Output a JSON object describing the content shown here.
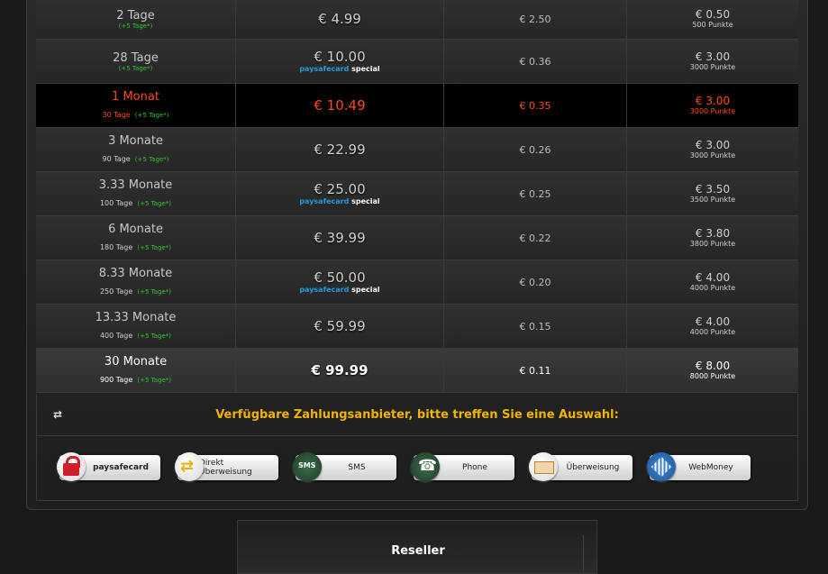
{
  "pricing_rows": [
    {
      "duration": "2 Tage",
      "sub": "",
      "bonus": "(+5 Tage*)",
      "price": "€ 4.99",
      "psc_special": false,
      "per_day": "€ 2.50",
      "points": "€ 0.50",
      "points_label": "500 Punkte",
      "style": "normal"
    },
    {
      "duration": "28 Tage",
      "sub": "",
      "bonus": "(+5 Tage*)",
      "price": "€ 10.00",
      "psc_special": true,
      "per_day": "€ 0.36",
      "points": "€ 3.00",
      "points_label": "3000 Punkte",
      "style": "normal"
    },
    {
      "duration": "1 Monat",
      "sub": "30 Tage",
      "bonus": "(+5 Tage*)",
      "price": "€ 10.49",
      "psc_special": false,
      "per_day": "€ 0.35",
      "points": "€ 3.00",
      "points_label": "3000 Punkte",
      "style": "highlight"
    },
    {
      "duration": "3 Monate",
      "sub": "90 Tage",
      "bonus": "(+5 Tage*)",
      "price": "€ 22.99",
      "psc_special": false,
      "per_day": "€ 0.26",
      "points": "€ 3.00",
      "points_label": "3000 Punkte",
      "style": "normal"
    },
    {
      "duration": "3.33 Monate",
      "sub": "100 Tage",
      "bonus": "(+5 Tage*)",
      "price": "€ 25.00",
      "psc_special": true,
      "per_day": "€ 0.25",
      "points": "€ 3.50",
      "points_label": "3500 Punkte",
      "style": "normal"
    },
    {
      "duration": "6 Monate",
      "sub": "180 Tage",
      "bonus": "(+5 Tage*)",
      "price": "€ 39.99",
      "psc_special": false,
      "per_day": "€ 0.22",
      "points": "€ 3.80",
      "points_label": "3800 Punkte",
      "style": "normal"
    },
    {
      "duration": "8.33 Monate",
      "sub": "250 Tage",
      "bonus": "(+5 Tage*)",
      "price": "€ 50.00",
      "psc_special": true,
      "per_day": "€ 0.20",
      "points": "€ 4.00",
      "points_label": "4000 Punkte",
      "style": "normal"
    },
    {
      "duration": "13.33 Monate",
      "sub": "400 Tage",
      "bonus": "(+5 Tage*)",
      "price": "€ 59.99",
      "psc_special": false,
      "per_day": "€ 0.15",
      "points": "€ 4.00",
      "points_label": "4000 Punkte",
      "style": "normal"
    },
    {
      "duration": "30 Monate",
      "sub": "900 Tage",
      "bonus": "(+5 Tage*)",
      "price": "€ 99.99",
      "psc_special": false,
      "per_day": "€ 0.11",
      "points": "€ 8.00",
      "points_label": "8000 Punkte",
      "style": "premium"
    }
  ],
  "psc_label": {
    "brand": "paysafecard",
    "special": "special"
  },
  "providers": {
    "title": "Verfügbare Zahlungsanbieter, bitte treffen Sie eine Auswahl:",
    "swap_icon": "⇄",
    "items": [
      {
        "label": "paysafecard",
        "icon": "lock-icon"
      },
      {
        "label": "Direkt Überweisung",
        "icon": "swap-arrows-icon"
      },
      {
        "label": "SMS",
        "icon": "sms-icon"
      },
      {
        "label": "Phone",
        "icon": "phone-icon"
      },
      {
        "label": "Überweisung",
        "icon": "bank-transfer-icon"
      },
      {
        "label": "WebMoney",
        "icon": "webmoney-icon"
      }
    ]
  },
  "reseller": {
    "title": "Reseller"
  },
  "colors": {
    "highlight": "#ff4a1a",
    "bonus": "#2ec82e",
    "title": "#f0b400",
    "paysafe_blue": "#1e9be0"
  }
}
